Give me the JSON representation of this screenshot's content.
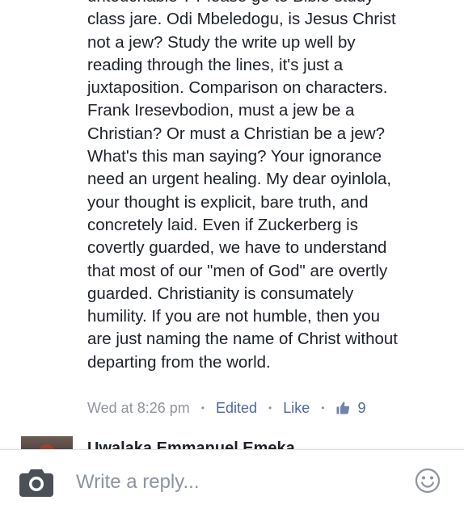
{
  "comment": {
    "text": "untouchable ? Please go to Bible study\nclass jare. Odi Mbeledogu, is Jesus Christ\nnot a jew? Study the write up well by\nreading through the lines, it's just a\njuxtaposition. Comparison on characters.\nFrank Iresevbodion, must a jew be a\nChristian? Or must a Christian be a jew?\nWhat's this man saying? Your ignorance\nneed an urgent healing. My dear oyinlola,\nyour thought is explicit, bare truth, and\nconcretely laid. Even if Zuckerberg is\ncovertly guarded, we have to understand\nthat most of our \"men of God\" are overtly\nguarded. Christianity is consumately\nhumility. If you are not humble, then you\nare just naming the name of Christ without\ndeparting from the world.",
    "timestamp": "Wed at 8:26 pm",
    "separator": "•",
    "edited_label": "Edited",
    "like_label": "Like",
    "like_count": "9",
    "like_icon": "thumbs-up-icon"
  },
  "next_comment": {
    "author": "Uwalaka Emmanuel Emeka"
  },
  "reply_bar": {
    "placeholder": "Write a reply...",
    "camera_icon": "camera-icon",
    "emoji_icon": "smiley-icon"
  },
  "colors": {
    "text": "#1d2129",
    "meta": "#90949c",
    "link": "#4b67a1",
    "icon": "#4b4f56"
  }
}
